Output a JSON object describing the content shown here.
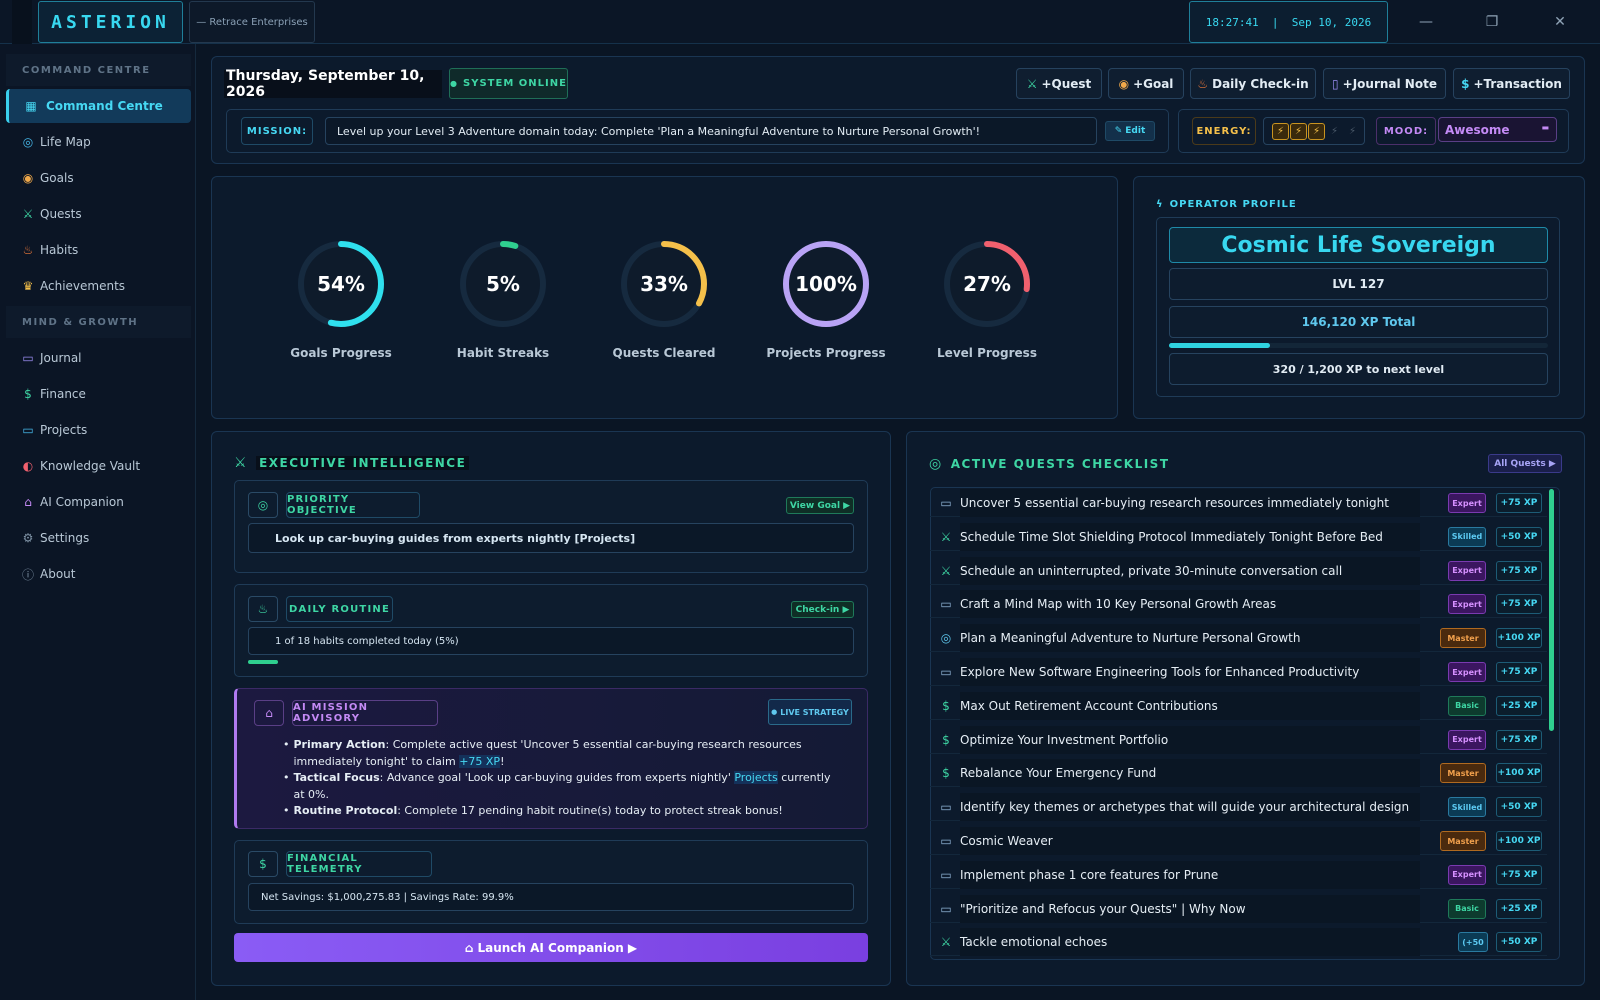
{
  "topbar": {
    "logo": "ASTERION",
    "company": "— Retrace Enterprises",
    "clock": "18:27:41  |  Sep 10, 2026",
    "minimize_icon": "minimize-icon",
    "restore_icon": "restore-icon",
    "close_icon": "close-icon"
  },
  "sidebar": {
    "section1": "COMMAND CENTRE",
    "section2": "MIND & GROWTH",
    "items": [
      {
        "label": "Command Centre",
        "icon": "grid-icon"
      },
      {
        "label": "Life Map",
        "icon": "compass-icon"
      },
      {
        "label": "Goals",
        "icon": "target-icon"
      },
      {
        "label": "Quests",
        "icon": "swords-icon"
      },
      {
        "label": "Habits",
        "icon": "flame-icon"
      },
      {
        "label": "Achievements",
        "icon": "trophy-icon"
      },
      {
        "label": "Journal",
        "icon": "book-icon"
      },
      {
        "label": "Finance",
        "icon": "dollar-icon"
      },
      {
        "label": "Projects",
        "icon": "folder-icon"
      },
      {
        "label": "Knowledge Vault",
        "icon": "brain-icon"
      },
      {
        "label": "AI Companion",
        "icon": "bot-icon"
      },
      {
        "label": "Settings",
        "icon": "gear-icon"
      },
      {
        "label": "About",
        "icon": "info-icon"
      }
    ]
  },
  "header": {
    "date": "Thursday, September 10, 2026",
    "status": "SYSTEM ONLINE",
    "actions": [
      "+Quest",
      "+Goal",
      "Daily Check-in",
      "+Journal Note",
      "+Transaction"
    ],
    "mission_label": "MISSION:",
    "mission_text": "Level up your Level 3 Adventure domain today: Complete 'Plan a Meaningful Adventure to Nurture Personal Growth'!",
    "edit_label": "Edit",
    "energy_label": "ENERGY:",
    "energy_level": 3,
    "energy_max": 5,
    "mood_label": "MOOD:",
    "mood_value": "Awesome"
  },
  "progress": [
    {
      "label": "Goals Progress",
      "value": "54%",
      "pct": 54,
      "color": "#2fe0ee"
    },
    {
      "label": "Habit Streaks",
      "value": "5%",
      "pct": 5,
      "color": "#2fcf8f"
    },
    {
      "label": "Quests Cleared",
      "value": "33%",
      "pct": 33,
      "color": "#f5c04a"
    },
    {
      "label": "Projects Progress",
      "value": "100%",
      "pct": 100,
      "color": "#b9a3f5"
    },
    {
      "label": "Level Progress",
      "value": "27%",
      "pct": 27,
      "color": "#f0606e"
    }
  ],
  "profile": {
    "heading": "OPERATOR PROFILE",
    "title": "Cosmic Life Sovereign",
    "level": "LVL 127",
    "xp_total": "146,120 XP Total",
    "xp_progress": 0.267,
    "xp_next": "320 / 1,200 XP to next level"
  },
  "exec": {
    "heading": "EXECUTIVE INTELLIGENCE",
    "priority_label": "PRIORITY OBJECTIVE",
    "priority_button": "View Goal ▶",
    "priority_text": "Look up car-buying guides from experts nightly [Projects]",
    "routine_label": "DAILY ROUTINE",
    "routine_button": "Check-in ▶",
    "routine_text": "1 of 18 habits completed today (5%)",
    "routine_progress": 0.05,
    "advisory_label": "AI MISSION ADVISORY",
    "advisory_badge": "LIVE STRATEGY",
    "bullet1_bold": "Primary Action",
    "bullet1_text": ": Complete active quest 'Uncover 5 essential car-buying research resources immediately tonight' to claim ",
    "bullet1_hl": "+75 XP",
    "bullet1_end": "!",
    "bullet2_bold": "Tactical Focus",
    "bullet2_text": ": Advance goal 'Look up car-buying guides from experts nightly' ",
    "bullet2_hl": "Projects",
    "bullet2_end": " currently at 0%.",
    "bullet3_bold": "Routine Protocol",
    "bullet3_text": ": Complete 17 pending habit routine(s) today to protect streak bonus!",
    "finance_label": "FINANCIAL TELEMETRY",
    "finance_text": "Net Savings: $1,000,275.83 | Savings Rate: 99.9%",
    "launch_button": "Launch AI Companion ▶"
  },
  "quests": {
    "heading": "ACTIVE QUESTS CHECKLIST",
    "all_button": "All Quests ▶",
    "rows": [
      {
        "title": "Uncover 5 essential car-buying research resources immediately tonight",
        "icon": "folder-icon",
        "diff": "Expert",
        "xp": "+75 XP"
      },
      {
        "title": "Schedule Time Slot Shielding Protocol Immediately Tonight Before Bed",
        "icon": "swords-icon",
        "diff": "Skilled",
        "xp": "+50 XP"
      },
      {
        "title": "Schedule an uninterrupted, private 30-minute conversation call",
        "icon": "swords-icon",
        "diff": "Expert",
        "xp": "+75 XP"
      },
      {
        "title": "Craft a Mind Map with 10 Key Personal Growth Areas",
        "icon": "folder-icon",
        "diff": "Expert",
        "xp": "+75 XP"
      },
      {
        "title": "Plan a Meaningful Adventure to Nurture Personal Growth",
        "icon": "compass-icon",
        "diff": "Master",
        "xp": "+100 XP"
      },
      {
        "title": "Explore New Software Engineering Tools for Enhanced Productivity",
        "icon": "folder-icon",
        "diff": "Expert",
        "xp": "+75 XP"
      },
      {
        "title": "Max Out Retirement Account Contributions",
        "icon": "dollar-icon",
        "diff": "Basic",
        "xp": "+25 XP"
      },
      {
        "title": "Optimize Your Investment Portfolio",
        "icon": "dollar-icon",
        "diff": "Expert",
        "xp": "+75 XP"
      },
      {
        "title": "Rebalance Your Emergency Fund",
        "icon": "dollar-icon",
        "diff": "Master",
        "xp": "+100 XP"
      },
      {
        "title": "Identify key themes or archetypes that will guide your architectural design",
        "icon": "folder-icon",
        "diff": "Skilled",
        "xp": "+50 XP"
      },
      {
        "title": "Cosmic Weaver",
        "icon": "folder-icon",
        "diff": "Master",
        "xp": "+100 XP"
      },
      {
        "title": "Implement phase 1 core features for Prune",
        "icon": "folder-icon",
        "diff": "Expert",
        "xp": "+75 XP"
      },
      {
        "title": "\"Prioritize and Refocus your Quests\" | Why Now",
        "icon": "folder-icon",
        "diff": "Basic",
        "xp": "+25 XP"
      },
      {
        "title": "Tackle emotional echoes",
        "icon": "swords-icon",
        "diff": "(+50",
        "xp": "+50 XP"
      }
    ]
  }
}
